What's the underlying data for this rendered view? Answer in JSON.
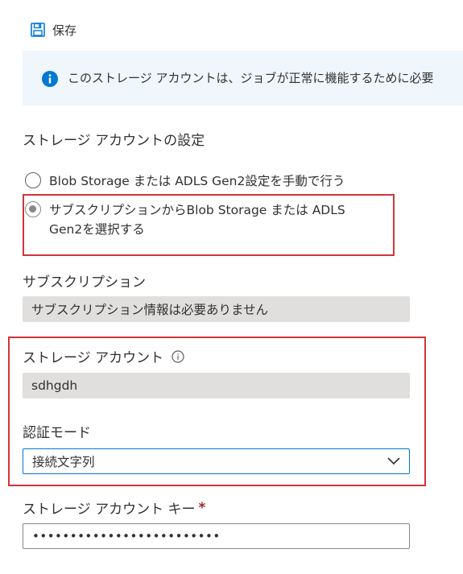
{
  "toolbar": {
    "save_label": "保存",
    "save_icon": "save-icon"
  },
  "banner": {
    "icon": "info-icon",
    "message": "このストレージ アカウントは、ジョブが正常に機能するために必要"
  },
  "settings": {
    "title": "ストレージ アカウントの設定",
    "options": [
      {
        "label": "Blob Storage または ADLS Gen2設定を手動で行う",
        "selected": false
      },
      {
        "label_line1": "サブスクリプションからBlob Storage または ADLS",
        "label_line2": "Gen2を選択する",
        "selected": true
      }
    ]
  },
  "subscription": {
    "label": "サブスクリプション",
    "value": "サブスクリプション情報は必要ありません"
  },
  "storage_account": {
    "label": "ストレージ アカウント",
    "info_icon": "info-circle-icon",
    "value": "sdhgdh"
  },
  "auth_mode": {
    "label": "認証モード",
    "selected": "接続文字列"
  },
  "account_key": {
    "label": "ストレージ アカウント キー",
    "required_marker": "*",
    "value": "•••••••••••••••••••••••••"
  },
  "colors": {
    "accent": "#0078d4",
    "highlight_box": "#d13438",
    "banner_bg": "#eff6fc",
    "readonly_bg": "#e1dfdd"
  }
}
